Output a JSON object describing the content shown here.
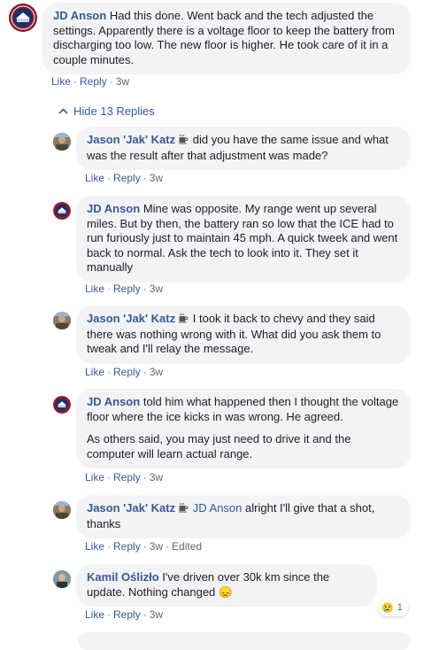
{
  "colors": {
    "link": "#385898",
    "bubble": "#f2f3f5",
    "meta": "#606770"
  },
  "comments": [
    {
      "author": "JD Anson",
      "paragraphs": [
        "Had this done. Went back and the tech adjusted the settings. Apparently there is a voltage floor to keep the battery from discharging too low. The new floor is higher. He took care of it in a couple minutes."
      ],
      "like": "Like",
      "reply": "Reply",
      "time": "3w"
    }
  ],
  "hide_replies": "Hide 13 Replies",
  "replies": [
    {
      "author": "Jason 'Jak' Katz",
      "icon": "coffee-icon",
      "text": "did you have the same issue and what was the result after that adjustment was made?",
      "like": "Like",
      "reply": "Reply",
      "time": "3w"
    },
    {
      "author": "JD Anson",
      "text": "Mine was opposite. My range went up several miles. But by then, the battery ran so low that the ICE had to run furiously just to maintain 45 mph. A quick tweek and went back to normal. Ask the tech to look into it. They set it manually",
      "like": "Like",
      "reply": "Reply",
      "time": "3w"
    },
    {
      "author": "Jason 'Jak' Katz",
      "icon": "coffee-icon",
      "text": "I took it back to chevy and they said there was nothing wrong with it. What did you ask them to tweak and I'll relay the message.",
      "like": "Like",
      "reply": "Reply",
      "time": "3w"
    },
    {
      "author": "JD Anson",
      "text": "told him what happened then I thought the voltage floor where the ice kicks in was wrong. He agreed.",
      "text2": "As others said, you may just need to drive it and the computer will learn actual range.",
      "like": "Like",
      "reply": "Reply",
      "time": "3w"
    },
    {
      "author": "Jason 'Jak' Katz",
      "icon": "coffee-icon",
      "mention": "JD Anson",
      "text": "alright I'll give that a shot, thanks",
      "like": "Like",
      "reply": "Reply",
      "time": "3w",
      "edited": "Edited"
    },
    {
      "author": "Kamil Oślizło",
      "text": "I've driven over 30k km since the update. Nothing changed",
      "emoji": "😞",
      "like": "Like",
      "reply": "Reply",
      "time": "3w",
      "reaction_emoji": "😢",
      "reaction_count": "1"
    }
  ]
}
